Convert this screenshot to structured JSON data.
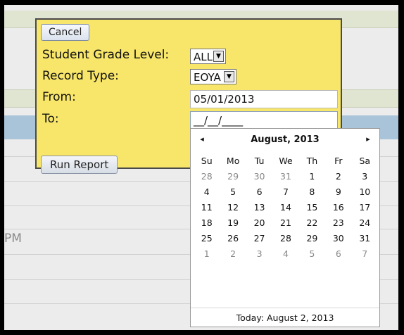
{
  "background": {
    "partial_text": "PM"
  },
  "panel": {
    "cancel_label": "Cancel",
    "grade_label": "Student Grade Level:",
    "grade_value": "ALL",
    "record_label": "Record Type:",
    "record_value": "EOYA",
    "from_label": "From:",
    "from_value": "05/01/2013",
    "to_label": "To:",
    "to_value": "__/__/____",
    "run_label": "Run Report"
  },
  "calendar": {
    "title": "August, 2013",
    "prev_icon": "◂",
    "next_icon": "▸",
    "weekdays": [
      "Su",
      "Mo",
      "Tu",
      "We",
      "Th",
      "Fr",
      "Sa"
    ],
    "weeks": [
      [
        {
          "d": "28",
          "o": true
        },
        {
          "d": "29",
          "o": true
        },
        {
          "d": "30",
          "o": true
        },
        {
          "d": "31",
          "o": true
        },
        {
          "d": "1"
        },
        {
          "d": "2"
        },
        {
          "d": "3"
        }
      ],
      [
        {
          "d": "4"
        },
        {
          "d": "5"
        },
        {
          "d": "6"
        },
        {
          "d": "7"
        },
        {
          "d": "8"
        },
        {
          "d": "9"
        },
        {
          "d": "10"
        }
      ],
      [
        {
          "d": "11"
        },
        {
          "d": "12"
        },
        {
          "d": "13"
        },
        {
          "d": "14"
        },
        {
          "d": "15"
        },
        {
          "d": "16"
        },
        {
          "d": "17"
        }
      ],
      [
        {
          "d": "18"
        },
        {
          "d": "19"
        },
        {
          "d": "20"
        },
        {
          "d": "21"
        },
        {
          "d": "22"
        },
        {
          "d": "23"
        },
        {
          "d": "24"
        }
      ],
      [
        {
          "d": "25"
        },
        {
          "d": "26"
        },
        {
          "d": "27"
        },
        {
          "d": "28"
        },
        {
          "d": "29"
        },
        {
          "d": "30"
        },
        {
          "d": "31"
        }
      ],
      [
        {
          "d": "1",
          "o": true
        },
        {
          "d": "2",
          "o": true
        },
        {
          "d": "3",
          "o": true
        },
        {
          "d": "4",
          "o": true
        },
        {
          "d": "5",
          "o": true
        },
        {
          "d": "6",
          "o": true
        },
        {
          "d": "7",
          "o": true
        }
      ]
    ],
    "today_label": "Today: August 2, 2013"
  },
  "colors": {
    "panel_bg": "#f8e66a",
    "band_blue": "#a9c4d9",
    "band_green": "#dfe5d0"
  }
}
